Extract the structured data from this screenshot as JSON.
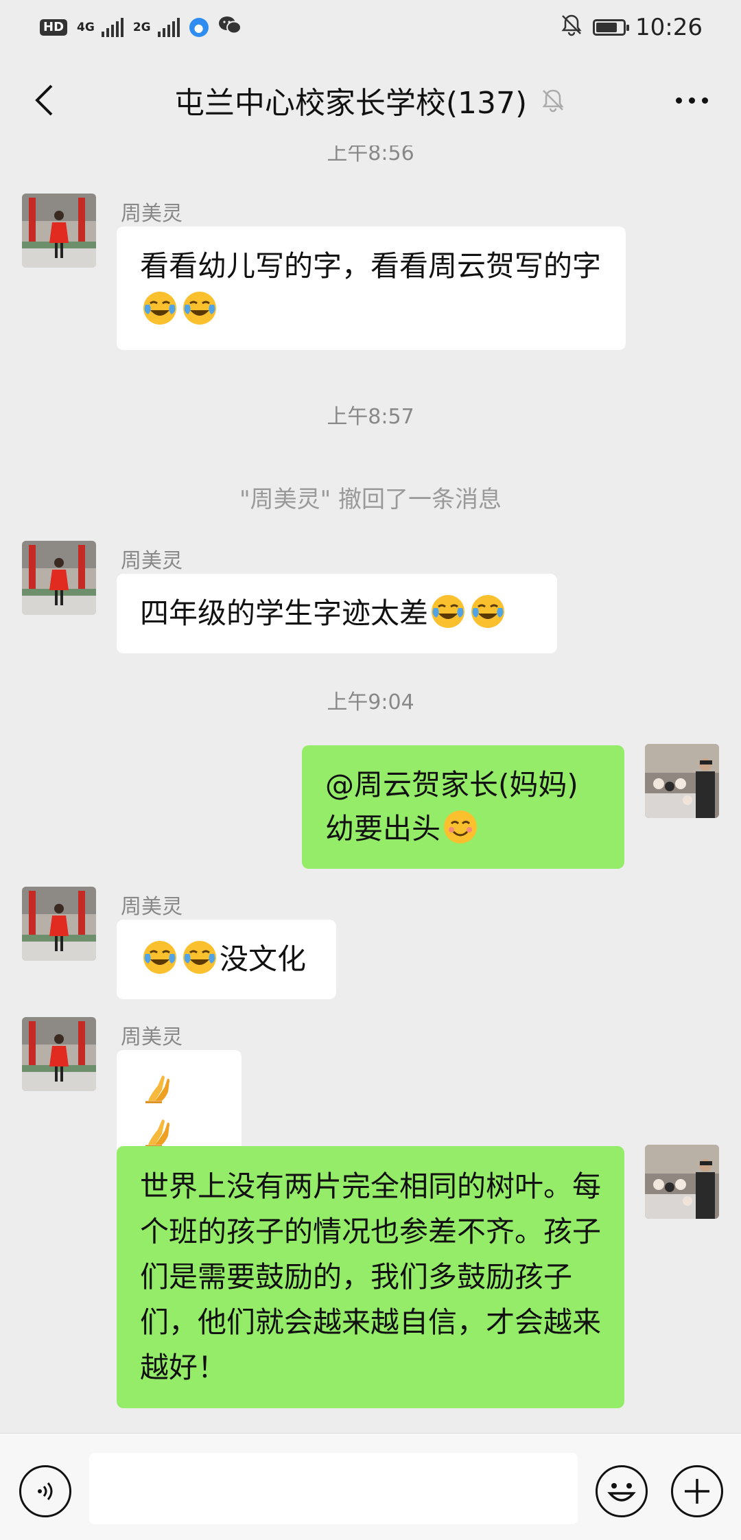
{
  "status_bar": {
    "hd_label": "HD",
    "net1_label": "4G",
    "net2_label": "2G",
    "battery_level": 0.8,
    "time": "10:26"
  },
  "header": {
    "title": "屯兰中心校家长学校(137)"
  },
  "messages": {
    "partial_time": "上午8:56",
    "m1": {
      "sender": "周美灵",
      "text": "看看幼儿写的字，看看周云贺写的字"
    },
    "time2": "上午8:57",
    "recall_note": "\"周美灵\" 撤回了一条消息",
    "m2": {
      "sender": "周美灵",
      "text": "四年级的学生字迹太差"
    },
    "time3": "上午9:04",
    "m3": {
      "text_line1": "@周云贺家长(妈妈)",
      "text_line2": "幼要出头"
    },
    "m4": {
      "sender": "周美灵",
      "text": "没文化"
    },
    "m5": {
      "sender": "周美灵"
    },
    "m6": {
      "text": "世界上没有两片完全相同的树叶。每个班的孩子的情况也参差不齐。孩子们是需要鼓励的，我们多鼓励孩子们，他们就会越来越自信，才会越来越好！"
    }
  },
  "input_bar": {
    "placeholder": ""
  },
  "colors": {
    "background": "#ededed",
    "outgoing_bubble": "#95ec69",
    "incoming_bubble": "#ffffff"
  },
  "icons": [
    "back-icon",
    "mute-icon",
    "more-icon",
    "voice-icon",
    "emoji-icon",
    "plus-icon",
    "laugh-cry-emoji",
    "smile-emoji",
    "pray-emoji"
  ]
}
